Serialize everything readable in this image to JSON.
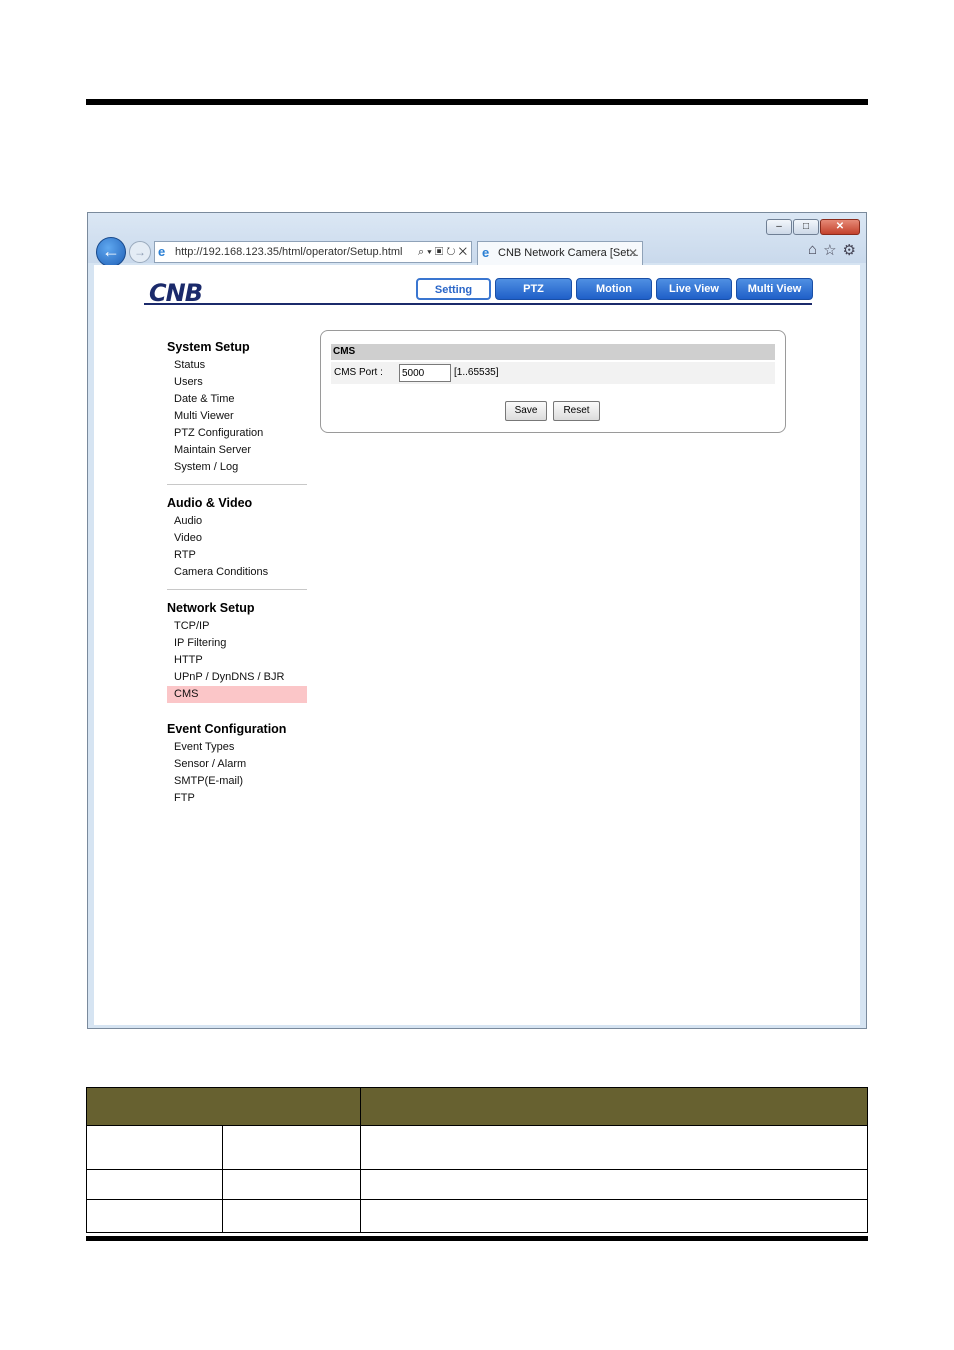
{
  "browser": {
    "window_buttons": {
      "minimize": "–",
      "maximize": "□",
      "close": "✕"
    },
    "address": "http://192.168.123.35/html/operator/Setup.html",
    "address_tools": "⌕ ▾ ▣ ↻ ✕",
    "tab_title": "CNB Network Camera [Set...",
    "tab_close": "✕",
    "toolbar_icons": [
      "home-icon",
      "star-icon",
      "gear-icon"
    ]
  },
  "app": {
    "logo": "CNB",
    "tabs": [
      "Setting",
      "PTZ",
      "Motion",
      "Live View",
      "Multi View"
    ],
    "active_tab": "Setting"
  },
  "sidebar": {
    "sections": [
      {
        "title": "System Setup",
        "items": [
          "Status",
          "Users",
          "Date & Time",
          "Multi Viewer",
          "PTZ Configuration",
          "Maintain Server",
          "System / Log"
        ]
      },
      {
        "title": "Audio & Video",
        "items": [
          "Audio",
          "Video",
          "RTP",
          "Camera Conditions"
        ]
      },
      {
        "title": "Network Setup",
        "items": [
          "TCP/IP",
          "IP Filtering",
          "HTTP",
          "UPnP / DynDNS / BJR",
          "CMS"
        ]
      },
      {
        "title": "Event Configuration",
        "items": [
          "Event Types",
          "Sensor / Alarm",
          "SMTP(E-mail)",
          "FTP"
        ]
      }
    ],
    "active_item": "CMS"
  },
  "cms": {
    "header": "CMS",
    "port_label": "CMS Port :",
    "port_value": "5000",
    "port_range": "[1..65535]",
    "save_label": "Save",
    "reset_label": "Reset"
  },
  "colors": {
    "brand": "#1b2a6b",
    "tab_blue": "#2a66c8",
    "active_highlight": "#fbc6c8",
    "table_header": "#676130"
  }
}
